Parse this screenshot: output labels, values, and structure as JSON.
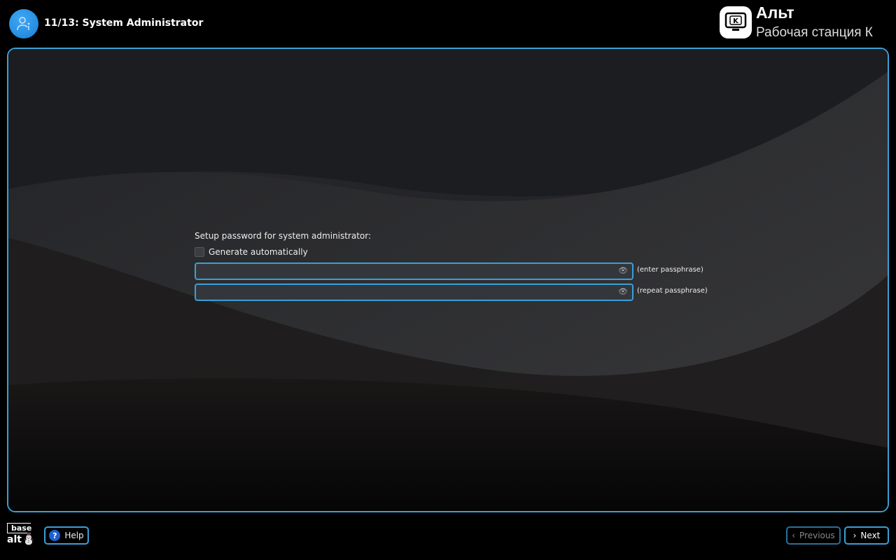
{
  "header": {
    "step_title": "11/13: System Administrator",
    "brand_title": "Альт",
    "brand_subtitle": "Рабочая станция К",
    "logo_letter": "K"
  },
  "form": {
    "prompt": "Setup password for system administrator:",
    "generate_label": "Generate automatically",
    "generate_checked": false,
    "password_value": "",
    "password_hint": "(enter passphrase)",
    "repeat_value": "",
    "repeat_hint": "(repeat passphrase)"
  },
  "footer": {
    "help_label": "Help",
    "previous_label": "Previous",
    "next_label": "Next",
    "basealt_logo": "base alt"
  },
  "colors": {
    "accent": "#3a9fd6",
    "background": "#000000"
  }
}
